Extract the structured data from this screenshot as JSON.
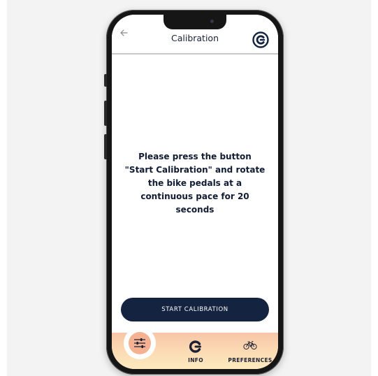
{
  "header": {
    "title": "Calibration",
    "back_icon": "arrow-left-icon",
    "logo_icon": "brand-c-logo-icon"
  },
  "main": {
    "instruction": "Please press the button \"Start Calibration\" and rotate the bike pedals at a continuous pace for 20 seconds",
    "start_button_label": "START CALIBRATION"
  },
  "nav": {
    "items": [
      {
        "id": "calibration",
        "label": "",
        "icon": "sliders-icon",
        "active": true
      },
      {
        "id": "info",
        "label": "INFO",
        "icon": "brand-c-icon",
        "active": false
      },
      {
        "id": "preferences",
        "label": "PREFERENCES",
        "icon": "bicycle-icon",
        "active": false
      }
    ]
  },
  "colors": {
    "primary": "#14233f",
    "active_nav": "#f5b293",
    "nav_gradient_top": "#f7c6a8",
    "nav_gradient_bottom": "#fde9bf"
  }
}
